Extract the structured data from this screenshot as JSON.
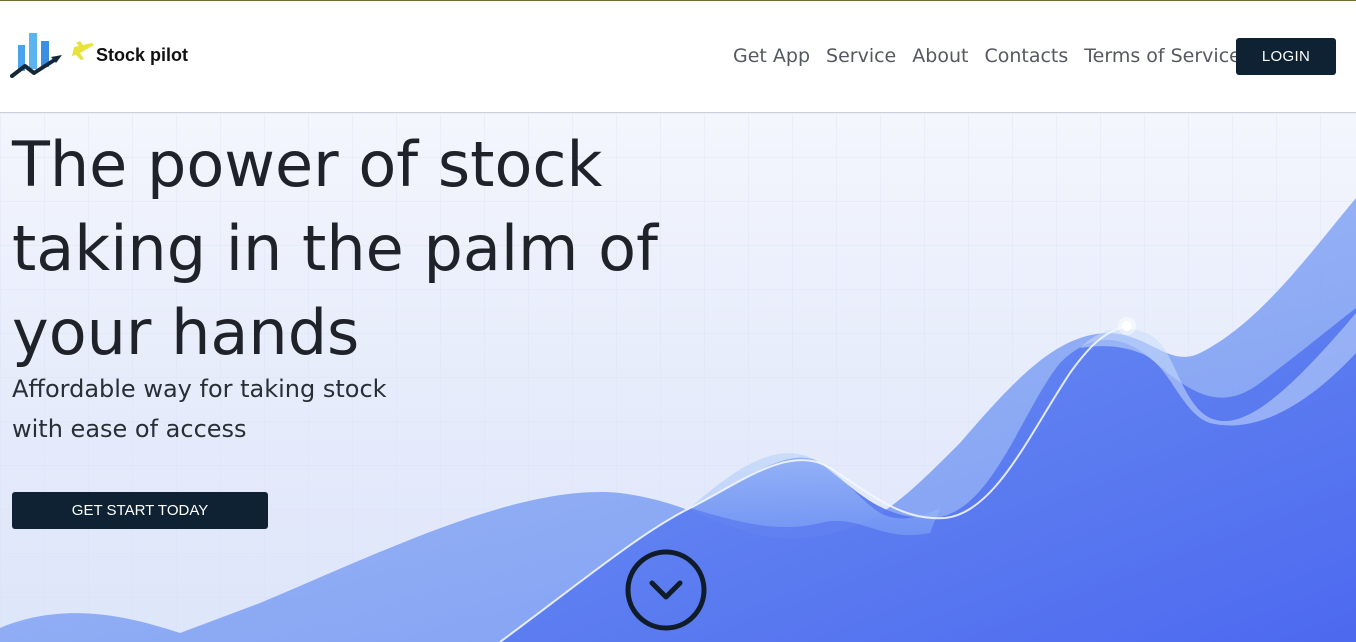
{
  "brand": {
    "name": "Stock pilot",
    "logo_icon": "bar-chart-plane-logo"
  },
  "nav": {
    "links": [
      {
        "label": "Get App"
      },
      {
        "label": "Service"
      },
      {
        "label": "About"
      },
      {
        "label": "Contacts"
      },
      {
        "label": "Terms of Service"
      }
    ],
    "login_label": "LOGIN"
  },
  "hero": {
    "title": "The power of stock taking in the palm of your hands",
    "subtitle": "Affordable way for taking stock with ease of access",
    "cta_label": "GET START TODAY",
    "scroll_icon": "chevron-down-circle-icon"
  },
  "colors": {
    "primary_dark": "#0e2233",
    "chart_blue": "#4f6ff0",
    "chart_light_blue": "#7fa4f4",
    "logo_blue": "#3f9be8",
    "logo_yellow": "#e8e03a"
  }
}
